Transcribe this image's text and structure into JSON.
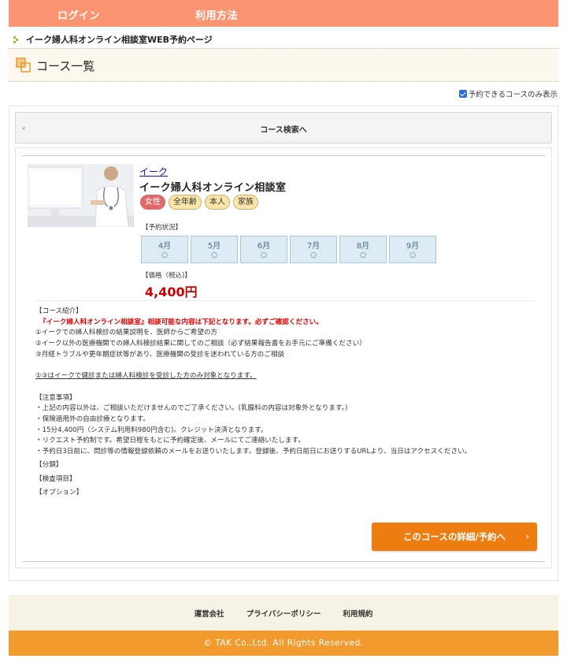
{
  "header": {
    "nav": [
      {
        "label": "ログイン"
      },
      {
        "label": "利用方法"
      }
    ]
  },
  "breadcrumb": {
    "text": "イーク婦人科オンライン相談室WEB予約ページ"
  },
  "page": {
    "title": "コース一覧"
  },
  "filter": {
    "label": "予約できるコースのみ表示",
    "checked": true
  },
  "search": {
    "label": "コース検索へ"
  },
  "course": {
    "category_link": "イーク",
    "name": "イーク婦人科オンライン相談室",
    "tags": [
      "女性",
      "全年齢",
      "本人",
      "家族"
    ],
    "availability_label": "【予約状況】",
    "months": [
      {
        "month": "4月",
        "mark": "○"
      },
      {
        "month": "5月",
        "mark": "○"
      },
      {
        "month": "6月",
        "mark": "○"
      },
      {
        "month": "7月",
        "mark": "○"
      },
      {
        "month": "8月",
        "mark": "○"
      },
      {
        "month": "9月",
        "mark": "○"
      }
    ],
    "price_label": "【価格（税込)】",
    "price": "4,400円",
    "description": {
      "intro_heading": "【コース紹介】",
      "red_note": "『イーク婦人科オンライン相談室』相談可能な内容は下記となります。必ずご確認ください。",
      "items": [
        "①イークでの婦人科検診の結果説明を、医師からご希望の方",
        "②イーク以外の医療機関での婦人科検診結果に関してのご相談（必ず結果報告書をお手元にご準備ください）",
        "③月経トラブルや更年期症状等があり、医療機関の受診を迷われている方のご相談"
      ],
      "underline_note": "①③はイークで健診または婦人科検診を受診した方のみ対象となります。",
      "notes_heading": "【注意事項】",
      "notes": [
        "・上記の内容以外は、ご相談いただけませんのでご了承ください。(乳腺科の内容は対象外となります。)",
        "・保険適用外の自由診療となります。",
        "・15分4,400円（システム利用料980円含む)。クレジット決済となります。",
        "・リクエスト予約制です。希望日程をもとに予約確定後、メールにてご連絡いたします。",
        "・予約日3日前に、問診等の情報登録依頼のメールをお送りいたします。登録後、予約日前日にお送りするURLより、当日はアクセスください。"
      ],
      "category_heading": "【分類】",
      "exam_heading": "【検査項目】",
      "option_heading": "【オプション】"
    },
    "detail_button": "このコースの詳細/予約へ"
  },
  "footer": {
    "links": [
      "運営会社",
      "プライバシーポリシー",
      "利用規約"
    ],
    "copyright": "© TAK Co.,Ltd. All Rights Reserved."
  },
  "colors": {
    "nav_bg": "#fb9470",
    "button_bg": "#ee7d11",
    "price": "#cc0000",
    "footer_bg": "#f29a2e"
  }
}
